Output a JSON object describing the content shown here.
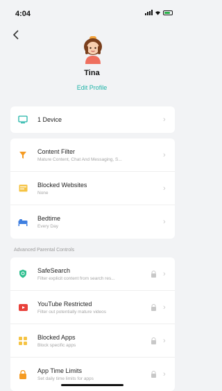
{
  "status_bar": {
    "time": "4:04"
  },
  "profile": {
    "name": "Tina",
    "edit_label": "Edit Profile"
  },
  "devices": {
    "label": "1 Device"
  },
  "controls": [
    {
      "title": "Content Filter",
      "subtitle": "Mature Content, Chat And Messaging, S..."
    },
    {
      "title": "Blocked Websites",
      "subtitle": "None"
    },
    {
      "title": "Bedtime",
      "subtitle": "Every Day"
    }
  ],
  "advanced_section_label": "Advanced Parental Controls",
  "advanced": [
    {
      "title": "SafeSearch",
      "subtitle": "Filter explicit content from search res..."
    },
    {
      "title": "YouTube Restricted",
      "subtitle": "Filter out potentially mature videos"
    },
    {
      "title": "Blocked Apps",
      "subtitle": "Block specific apps"
    },
    {
      "title": "App Time Limits",
      "subtitle": "Set daily time limits for apps"
    }
  ],
  "colors": {
    "accent": "#1fb3a7",
    "content_filter_icon": "#f59b23",
    "blocked_websites_icon": "#f5c343",
    "bedtime_icon": "#3f7fe0",
    "safesearch_icon": "#2fbf8f",
    "youtube_icon": "#e8413a",
    "blocked_apps_icon": "#f5c343",
    "app_time_limits_icon": "#f59b23"
  }
}
